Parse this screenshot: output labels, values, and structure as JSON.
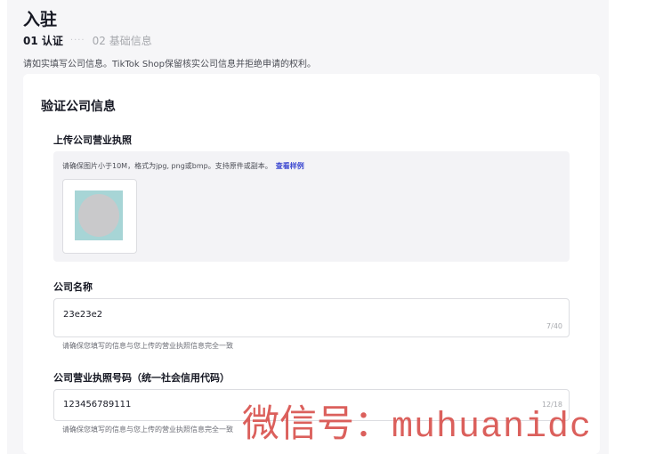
{
  "header": {
    "title": "入驻",
    "steps": [
      {
        "label": "01 认证",
        "active": true
      },
      {
        "label": "02 基础信息",
        "active": false
      }
    ],
    "step_separator": "····",
    "intro": "请如实填写公司信息。TikTok Shop保留核实公司信息并拒绝申请的权利。"
  },
  "card": {
    "section_title": "验证公司信息",
    "upload": {
      "label": "上传公司营业执照",
      "hint": "请确保图片小于10M，格式为jpg, png或bmp。支持原件或副本。",
      "sample_link": "查看样例"
    },
    "company_name": {
      "label": "公司名称",
      "value": "23e23e2",
      "counter": "7/40",
      "helper": "请确保您填写的信息与您上传的营业执照信息完全一致"
    },
    "license_number": {
      "label": "公司营业执照号码（统一社会信用代码）",
      "value": "123456789111",
      "counter": "12/18",
      "helper": "请确保您填写的信息与您上传的营业执照信息完全一致"
    }
  },
  "watermark": {
    "cn": "微信号：",
    "latin": "muhuanidc"
  },
  "colors": {
    "link": "#3e4ad1",
    "panel_bg": "#f6f6f8",
    "watermark": "#d9534f"
  }
}
